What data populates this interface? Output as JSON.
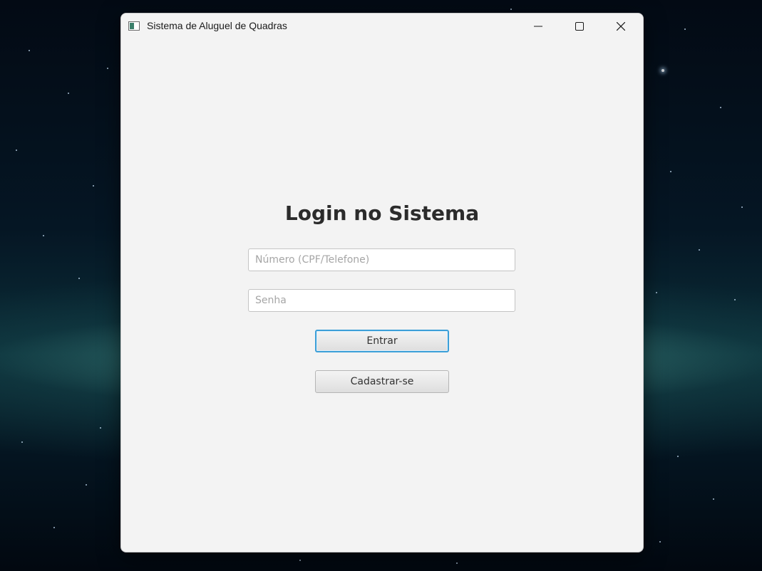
{
  "window": {
    "title": "Sistema de Aluguel de Quadras",
    "controls": {
      "minimize": "minimize-icon",
      "maximize": "maximize-icon",
      "close": "close-icon"
    }
  },
  "login": {
    "title": "Login no Sistema",
    "cpf_placeholder": "Número (CPF/Telefone)",
    "cpf_value": "",
    "password_placeholder": "Senha",
    "password_value": "",
    "submit_label": "Entrar",
    "register_label": "Cadastrar-se"
  },
  "colors": {
    "window_bg": "#f3f3f3",
    "focus_border": "#3c9fd8",
    "title_text": "#2b2b2b"
  }
}
